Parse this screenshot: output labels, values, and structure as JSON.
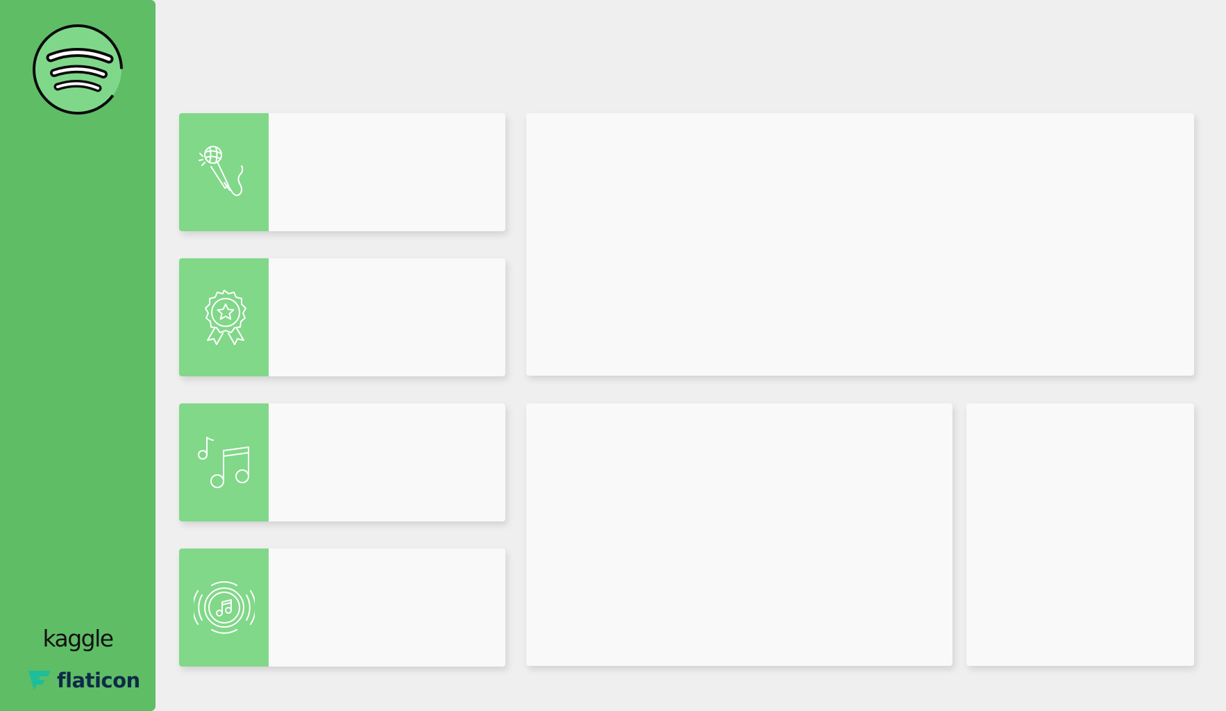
{
  "sidebar": {
    "logo_icon": "spotify-icon",
    "brands": {
      "kaggle": "kaggle",
      "flaticon": "flaticon",
      "flaticon_icon": "flaticon-logo-icon"
    }
  },
  "kpi_cards": [
    {
      "icon": "microphone-icon"
    },
    {
      "icon": "award-badge-icon"
    },
    {
      "icon": "music-notes-icon"
    },
    {
      "icon": "music-speaker-icon"
    }
  ],
  "colors": {
    "sidebar_green": "#5fbd66",
    "icon_box_green": "#80d888",
    "logo_green": "#7fd88a",
    "background": "#efefef",
    "card": "#f9f9f9",
    "flaticon_teal": "#1ebe9a",
    "flaticon_navy": "#0e2a47"
  }
}
